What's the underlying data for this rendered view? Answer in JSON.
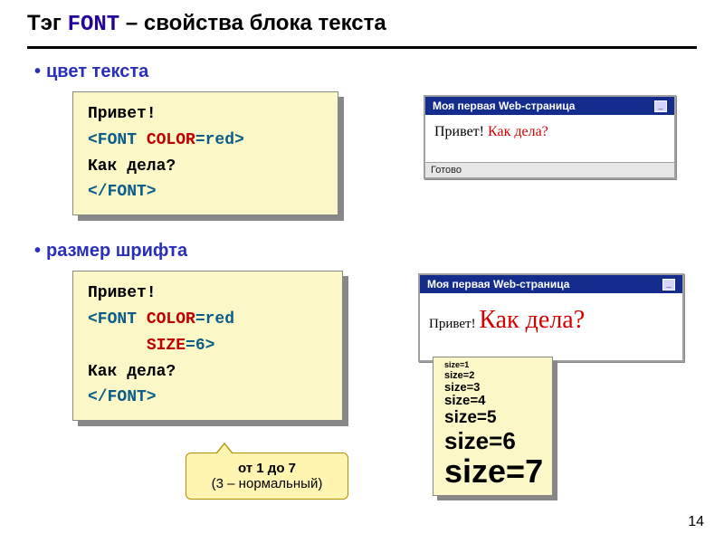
{
  "title": {
    "pre": "Тэг ",
    "kw": "FONT",
    "post": " – свойства блока текста"
  },
  "sections": {
    "color": {
      "label": "цвет текста"
    },
    "size": {
      "label": "размер шрифта"
    }
  },
  "code1": {
    "l1": "Привет!",
    "l2_open": "<FONT ",
    "l2_attr": "COLOR",
    "l2_rest": "=red>",
    "l3": "Как дела?",
    "l4": "</FONT>"
  },
  "code2": {
    "l1": "Привет!",
    "l2_open": "<FONT ",
    "l2_attr": "COLOR",
    "l2_rest": "=red",
    "l3_indent": "      ",
    "l3_attr": "SIZE",
    "l3_rest": "=6>",
    "l4": "Как дела?",
    "l5": "</FONT>"
  },
  "browser": {
    "title": "Моя первая Web-страница",
    "status": "Готово",
    "text_black": "Привет! ",
    "text_red": "Как дела?"
  },
  "sizes": {
    "s1": "size=1",
    "s2": "size=2",
    "s3": "size=3",
    "s4": "size=4",
    "s5": "size=5",
    "s6": "size=6",
    "s7": "size=7"
  },
  "callout": {
    "line1": "от 1 до 7",
    "line2": "(3 – нормальный)"
  },
  "pagenum": "14"
}
